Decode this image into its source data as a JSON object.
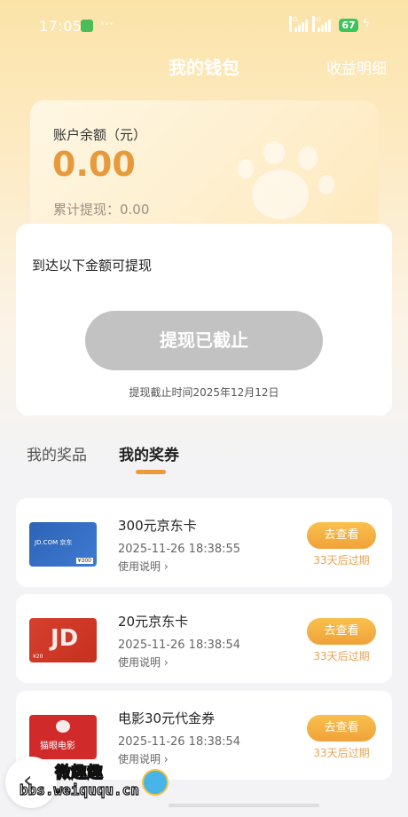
{
  "status_bar": {
    "time": "17:05",
    "dots": "···",
    "battery": "67",
    "signal_labels": [
      "5G",
      "5G"
    ]
  },
  "header": {
    "title": "我的钱包",
    "right_link": "收益明细"
  },
  "balance": {
    "label": "账户余额（元）",
    "value": "0.00",
    "withdrawn": "累计提现：0.00"
  },
  "withdraw": {
    "hint": "到达以下金额可提现",
    "button": "提现已截止",
    "deadline": "提现截止时间2025年12月12日"
  },
  "tabs": [
    {
      "label": "我的奖品",
      "active": false
    },
    {
      "label": "我的奖券",
      "active": true
    }
  ],
  "coupons": [
    {
      "title": "300元京东卡",
      "time": "2025-11-26 18:38:55",
      "help": "使用说明",
      "button": "去查看",
      "expire": "33天后过期",
      "img_label": "JD.COM 京东",
      "img_sub": "¥300"
    },
    {
      "title": "20元京东卡",
      "time": "2025-11-26 18:38:54",
      "help": "使用说明",
      "button": "去查看",
      "expire": "33天后过期",
      "img_label": "JD",
      "img_sub": "¥20"
    },
    {
      "title": "电影30元代金券",
      "time": "2025-11-26 18:38:54",
      "help": "使用说明",
      "button": "去查看",
      "expire": "33天后过期",
      "img_label": "猫眼电影",
      "img_sub": ""
    }
  ],
  "watermark": {
    "line1": "微趣趣",
    "line2": "bbs.weiququ.cn"
  },
  "colors": {
    "accent": "#ec9a3e",
    "balance_value": "#e79a3c",
    "disabled_button": "#c2c2c2",
    "expire_text": "#e8a254"
  }
}
